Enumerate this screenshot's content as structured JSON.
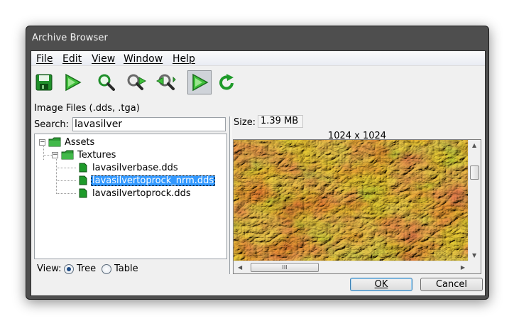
{
  "window": {
    "title": "Archive Browser"
  },
  "menu": {
    "items": [
      {
        "label": "File"
      },
      {
        "label": "Edit"
      },
      {
        "label": "View"
      },
      {
        "label": "Window"
      },
      {
        "label": "Help"
      }
    ]
  },
  "toolbar": {
    "buttons": [
      {
        "icon": "save-icon"
      },
      {
        "icon": "play-icon"
      },
      {
        "icon": "zoom-icon"
      },
      {
        "icon": "zoom-next-icon"
      },
      {
        "icon": "zoom-prev-icon"
      },
      {
        "icon": "play-icon",
        "pressed": true
      },
      {
        "icon": "refresh-icon"
      }
    ]
  },
  "left": {
    "heading": "Image Files (.dds, .tga)",
    "search_label": "Search:",
    "search_value": "lavasilver",
    "tree": [
      {
        "label": "Assets",
        "type": "folder",
        "expander": "−"
      },
      {
        "label": "Textures",
        "type": "folder",
        "expander": "−"
      },
      {
        "label": "lavasilverbase.dds",
        "type": "file"
      },
      {
        "label": "lavasilvertoprock_nrm.dds",
        "type": "file",
        "selected": true
      },
      {
        "label": "lavasilvertoprock.dds",
        "type": "file"
      }
    ],
    "view_label": "View:",
    "view_options": [
      {
        "label": "Tree",
        "checked": true
      },
      {
        "label": "Table",
        "checked": false
      }
    ]
  },
  "right": {
    "size_label": "Size:",
    "size_value": "1.39 MB",
    "dimensions": "1024 x 1024",
    "hscroll_grip": "III"
  },
  "buttons": {
    "ok": "OK",
    "cancel": "Cancel"
  },
  "colors": {
    "selection": "#3399ff",
    "title_bar": "#4e4e4e",
    "icon_green": "#1e9a2a"
  }
}
